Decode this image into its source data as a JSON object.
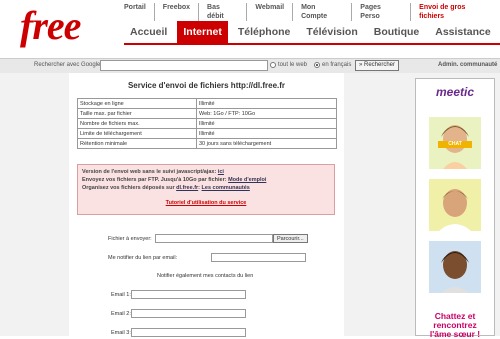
{
  "header": {
    "logo": "free",
    "top_links": [
      "Portail",
      "Freebox",
      "Bas débit",
      "Webmail",
      "Mon Compte",
      "Pages Perso",
      "Envoi de gros fichiers"
    ],
    "main_tabs": [
      "Accueil",
      "Internet",
      "Téléphone",
      "Télévision",
      "Boutique",
      "Assistance"
    ],
    "active_tab": "Internet"
  },
  "search": {
    "label": "Rechercher avec Google",
    "value": "",
    "option_web": "tout le web",
    "option_fr": "en français",
    "button": "» Rechercher",
    "admin": "Admin. communauté"
  },
  "main": {
    "title": "Service d'envoi de fichiers http://dl.free.fr",
    "info_rows": [
      {
        "label": "Stockage en ligne",
        "value": "Illimité"
      },
      {
        "label": "Taille max. par fichier",
        "value": "Web: 1Go / FTP: 10Go"
      },
      {
        "label": "Nombre de fichiers max.",
        "value": "Illimité"
      },
      {
        "label": "Limite de téléchargement",
        "value": "Illimité"
      },
      {
        "label": "Rétention minimale",
        "value": "30 jours sans téléchargement"
      }
    ],
    "notice": {
      "line1_text": "Version de l'envoi web sans le suivi javascript/ajax: ",
      "line1_link": "ici",
      "line2_text": "Envoyez vos fichiers par FTP. Jusqu'à 10Go par fichier: ",
      "line2_link": "Mode d'emploi",
      "line3_text": "Organisez vos fichiers déposés sur ",
      "line3_link1": "dl.free.fr",
      "line3_mid": ": ",
      "line3_link2": "Les communautés",
      "tutorial": "Tutoriel d'utilisation du service"
    },
    "form": {
      "file_label": "Fichier à envoyer:",
      "file_value": "",
      "browse_button": "Parcourir...",
      "notify_label": "Me notifier du lien par email:",
      "notify_value": "",
      "contacts_label": "Notifier également mes contacts du lien",
      "email1_label": "Email 1:",
      "email1_value": "",
      "email2_label": "Email 2:",
      "email2_value": "",
      "email3_label": "Email 3:",
      "email3_value": ""
    }
  },
  "ad": {
    "brand": "meetic",
    "chat_label": "CHAT",
    "slogan_line1": "Chattez et",
    "slogan_line2": "rencontrez",
    "slogan_line3": "l'âme sœur !",
    "accent_color": "#cc0066",
    "brand_color": "#6a2a8a"
  },
  "colors": {
    "brand_red": "#cc0000",
    "notice_bg": "#fbe2e2"
  }
}
